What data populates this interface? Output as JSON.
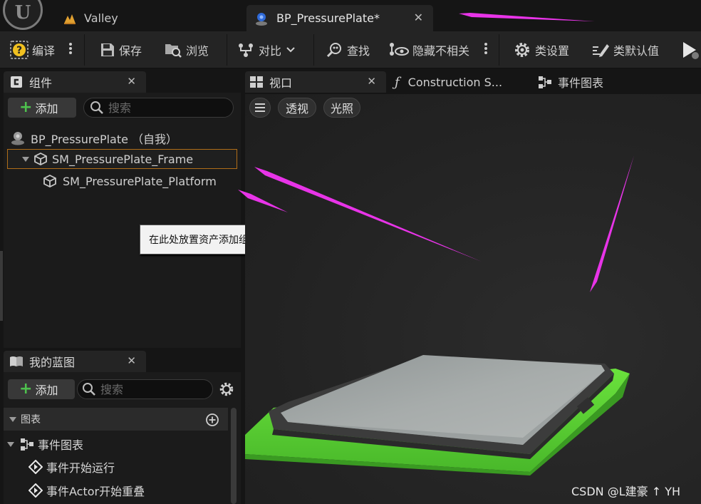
{
  "tabs": {
    "valley": "Valley",
    "blueprint": "BP_PressurePlate*"
  },
  "toolbar": {
    "compile": "编译",
    "save": "保存",
    "browse": "浏览",
    "diff": "对比",
    "find": "查找",
    "hide_unrelated": "隐藏不相关",
    "class_settings": "类设置",
    "class_defaults": "类默认值"
  },
  "components": {
    "title": "组件",
    "add": "添加",
    "search_placeholder": "搜索",
    "root": "BP_PressurePlate （自我）",
    "items": [
      "SM_PressurePlate_Frame",
      "SM_PressurePlate_Platform"
    ],
    "tooltip": "在此处放置资产添加组件。"
  },
  "my_blueprint": {
    "title": "我的蓝图",
    "add": "添加",
    "search_placeholder": "搜索",
    "section": "图表",
    "event_graph": "事件图表",
    "events": [
      "事件开始运行",
      "事件Actor开始重叠"
    ]
  },
  "viewport_tabs": {
    "viewport": "视口",
    "construction": "Construction S...",
    "event_graph": "事件图表"
  },
  "viewport": {
    "menu_icon": "hamburger-icon",
    "perspective": "透视",
    "lighting": "光照"
  },
  "colors": {
    "annotation_arrow": "#e834e8",
    "selection_border": "#b06d18",
    "plate_frame": "#5ed435",
    "plate_top": "#9ea3a3",
    "add_plus": "#4ec24e"
  },
  "watermark": "CSDN @L建豪 ↑ YH"
}
